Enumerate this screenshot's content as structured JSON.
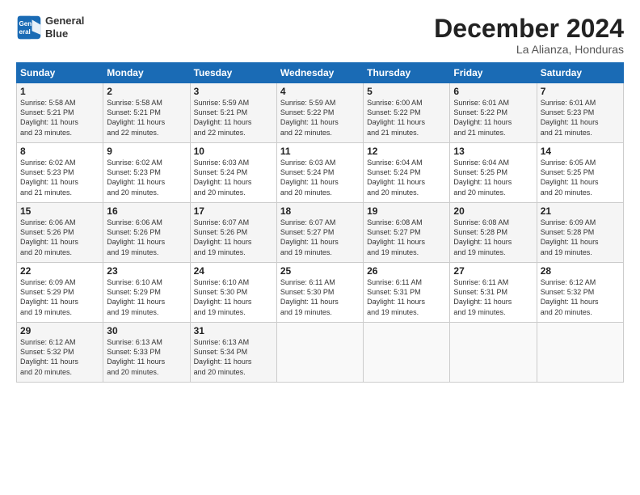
{
  "logo": {
    "line1": "General",
    "line2": "Blue"
  },
  "title": "December 2024",
  "location": "La Alianza, Honduras",
  "days_header": [
    "Sunday",
    "Monday",
    "Tuesday",
    "Wednesday",
    "Thursday",
    "Friday",
    "Saturday"
  ],
  "weeks": [
    [
      {
        "day": "1",
        "info": "Sunrise: 5:58 AM\nSunset: 5:21 PM\nDaylight: 11 hours\nand 23 minutes."
      },
      {
        "day": "2",
        "info": "Sunrise: 5:58 AM\nSunset: 5:21 PM\nDaylight: 11 hours\nand 22 minutes."
      },
      {
        "day": "3",
        "info": "Sunrise: 5:59 AM\nSunset: 5:21 PM\nDaylight: 11 hours\nand 22 minutes."
      },
      {
        "day": "4",
        "info": "Sunrise: 5:59 AM\nSunset: 5:22 PM\nDaylight: 11 hours\nand 22 minutes."
      },
      {
        "day": "5",
        "info": "Sunrise: 6:00 AM\nSunset: 5:22 PM\nDaylight: 11 hours\nand 21 minutes."
      },
      {
        "day": "6",
        "info": "Sunrise: 6:01 AM\nSunset: 5:22 PM\nDaylight: 11 hours\nand 21 minutes."
      },
      {
        "day": "7",
        "info": "Sunrise: 6:01 AM\nSunset: 5:23 PM\nDaylight: 11 hours\nand 21 minutes."
      }
    ],
    [
      {
        "day": "8",
        "info": "Sunrise: 6:02 AM\nSunset: 5:23 PM\nDaylight: 11 hours\nand 21 minutes."
      },
      {
        "day": "9",
        "info": "Sunrise: 6:02 AM\nSunset: 5:23 PM\nDaylight: 11 hours\nand 20 minutes."
      },
      {
        "day": "10",
        "info": "Sunrise: 6:03 AM\nSunset: 5:24 PM\nDaylight: 11 hours\nand 20 minutes."
      },
      {
        "day": "11",
        "info": "Sunrise: 6:03 AM\nSunset: 5:24 PM\nDaylight: 11 hours\nand 20 minutes."
      },
      {
        "day": "12",
        "info": "Sunrise: 6:04 AM\nSunset: 5:24 PM\nDaylight: 11 hours\nand 20 minutes."
      },
      {
        "day": "13",
        "info": "Sunrise: 6:04 AM\nSunset: 5:25 PM\nDaylight: 11 hours\nand 20 minutes."
      },
      {
        "day": "14",
        "info": "Sunrise: 6:05 AM\nSunset: 5:25 PM\nDaylight: 11 hours\nand 20 minutes."
      }
    ],
    [
      {
        "day": "15",
        "info": "Sunrise: 6:06 AM\nSunset: 5:26 PM\nDaylight: 11 hours\nand 20 minutes."
      },
      {
        "day": "16",
        "info": "Sunrise: 6:06 AM\nSunset: 5:26 PM\nDaylight: 11 hours\nand 19 minutes."
      },
      {
        "day": "17",
        "info": "Sunrise: 6:07 AM\nSunset: 5:26 PM\nDaylight: 11 hours\nand 19 minutes."
      },
      {
        "day": "18",
        "info": "Sunrise: 6:07 AM\nSunset: 5:27 PM\nDaylight: 11 hours\nand 19 minutes."
      },
      {
        "day": "19",
        "info": "Sunrise: 6:08 AM\nSunset: 5:27 PM\nDaylight: 11 hours\nand 19 minutes."
      },
      {
        "day": "20",
        "info": "Sunrise: 6:08 AM\nSunset: 5:28 PM\nDaylight: 11 hours\nand 19 minutes."
      },
      {
        "day": "21",
        "info": "Sunrise: 6:09 AM\nSunset: 5:28 PM\nDaylight: 11 hours\nand 19 minutes."
      }
    ],
    [
      {
        "day": "22",
        "info": "Sunrise: 6:09 AM\nSunset: 5:29 PM\nDaylight: 11 hours\nand 19 minutes."
      },
      {
        "day": "23",
        "info": "Sunrise: 6:10 AM\nSunset: 5:29 PM\nDaylight: 11 hours\nand 19 minutes."
      },
      {
        "day": "24",
        "info": "Sunrise: 6:10 AM\nSunset: 5:30 PM\nDaylight: 11 hours\nand 19 minutes."
      },
      {
        "day": "25",
        "info": "Sunrise: 6:11 AM\nSunset: 5:30 PM\nDaylight: 11 hours\nand 19 minutes."
      },
      {
        "day": "26",
        "info": "Sunrise: 6:11 AM\nSunset: 5:31 PM\nDaylight: 11 hours\nand 19 minutes."
      },
      {
        "day": "27",
        "info": "Sunrise: 6:11 AM\nSunset: 5:31 PM\nDaylight: 11 hours\nand 19 minutes."
      },
      {
        "day": "28",
        "info": "Sunrise: 6:12 AM\nSunset: 5:32 PM\nDaylight: 11 hours\nand 20 minutes."
      }
    ],
    [
      {
        "day": "29",
        "info": "Sunrise: 6:12 AM\nSunset: 5:32 PM\nDaylight: 11 hours\nand 20 minutes."
      },
      {
        "day": "30",
        "info": "Sunrise: 6:13 AM\nSunset: 5:33 PM\nDaylight: 11 hours\nand 20 minutes."
      },
      {
        "day": "31",
        "info": "Sunrise: 6:13 AM\nSunset: 5:34 PM\nDaylight: 11 hours\nand 20 minutes."
      },
      {
        "day": "",
        "info": ""
      },
      {
        "day": "",
        "info": ""
      },
      {
        "day": "",
        "info": ""
      },
      {
        "day": "",
        "info": ""
      }
    ]
  ]
}
